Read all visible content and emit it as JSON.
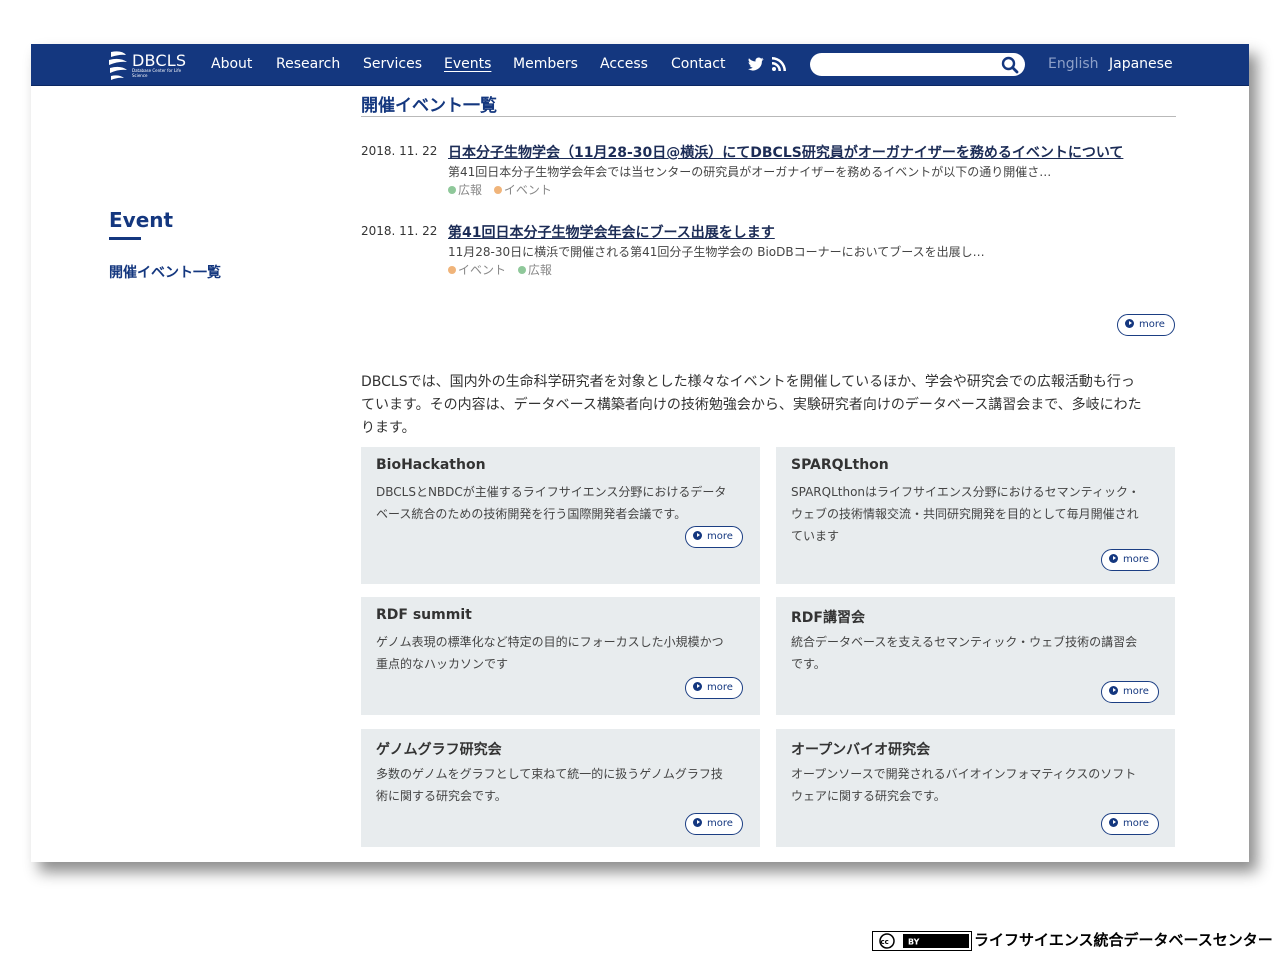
{
  "nav": {
    "logo_text": "DBCLS",
    "logo_sub": "Database Center for Life Science",
    "items": [
      "About",
      "Research",
      "Services",
      "Events",
      "Members",
      "Access",
      "Contact"
    ],
    "active": "Events",
    "search_placeholder": "",
    "lang_en": "English",
    "lang_ja": "Japanese"
  },
  "sidebar": {
    "title": "Event",
    "link": "開催イベント一覧"
  },
  "main": {
    "page_title": "開催イベント一覧",
    "news": [
      {
        "date": "2018. 11. 22",
        "title": "日本分子生物学会（11月28-30日@横浜）にてDBCLS研究員がオーガナイザーを務めるイベントについて",
        "desc": "第41回日本分子生物学会年会では当センターの研究員がオーガナイザーを務めるイベントが以下の通り開催さ…",
        "tags": [
          {
            "label": "広報",
            "color": "#8fc89a"
          },
          {
            "label": "イベント",
            "color": "#f0b47a"
          }
        ]
      },
      {
        "date": "2018. 11. 22",
        "title": "第41回日本分子生物学会年会にブース出展をします",
        "desc": "11月28-30日に横浜で開催される第41回分子生物学会の BioDBコーナーにおいてブースを出展し…",
        "tags": [
          {
            "label": "イベント",
            "color": "#f0b47a"
          },
          {
            "label": "広報",
            "color": "#8fc89a"
          }
        ]
      }
    ],
    "more_label": "more",
    "intro_lines": [
      "DBCLSでは、国内外の生命科学研究者を対象とした様々なイベントを開催しているほか、学会や研究会での広報活動も行っ",
      "ています。その内容は、データベース構築者向けの技術勉強会から、実験研究者向けのデータベース講習会まで、多岐にわた",
      "ります。"
    ],
    "cards": [
      {
        "title": "BioHackathon",
        "desc_lines": [
          "DBCLSとNBDCが主催するライフサイエンス分野におけるデータ",
          "ベース統合のための技術開発を行う国際開発者会議です。"
        ]
      },
      {
        "title": "SPARQLthon",
        "desc_lines": [
          "SPARQLthonはライフサイエンス分野におけるセマンティック・",
          "ウェブの技術情報交流・共同研究開発を目的として毎月開催され",
          "ています"
        ]
      },
      {
        "title": "RDF summit",
        "desc_lines": [
          "ゲノム表現の標準化など特定の目的にフォーカスした小規模かつ",
          "重点的なハッカソンです"
        ]
      },
      {
        "title": "RDF講習会",
        "desc_lines": [
          "統合データベースを支えるセマンティック・ウェブ技術の講習会",
          "です。"
        ]
      },
      {
        "title": "ゲノムグラフ研究会",
        "desc_lines": [
          "多数のゲノムをグラフとして束ねて統一的に扱うゲノムグラフ技",
          "術に関する研究会です。"
        ]
      },
      {
        "title": "オープンバイオ研究会",
        "desc_lines": [
          "オープンソースで開発されるバイオインフォマティクスのソフト",
          "ウェアに関する研究会です。"
        ]
      }
    ]
  },
  "footer": {
    "license_badge": "cc BY",
    "org": "ライフサイエンス統合データベースセンター"
  },
  "colors": {
    "nav_bg": "#14377f",
    "accent": "#14377f",
    "card_bg": "#e8ecee",
    "tag_green": "#8fc89a",
    "tag_orange": "#f0b47a"
  }
}
